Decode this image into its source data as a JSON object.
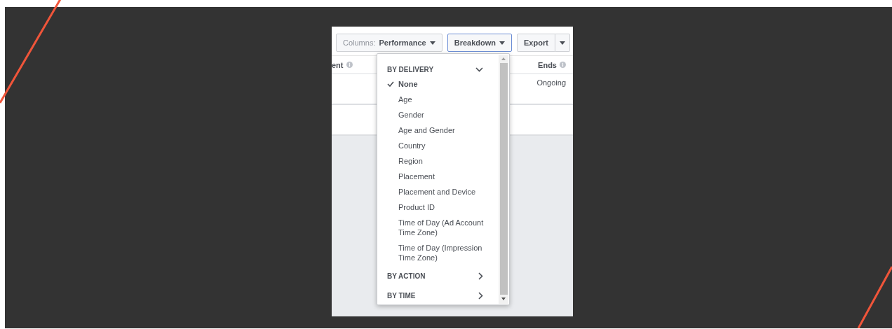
{
  "toolbar": {
    "buttons": [
      {
        "kind": "columns",
        "prefix": "Columns:",
        "label": "Performance",
        "selected": false
      },
      {
        "kind": "dropdown",
        "label": "Breakdown",
        "selected": true
      },
      {
        "kind": "split",
        "label": "Export",
        "selected": false
      }
    ]
  },
  "table": {
    "columns": [
      {
        "label": "ent"
      },
      {
        "label": "Ends"
      }
    ],
    "rows": [
      {
        "ends": "Ongoing"
      },
      {
        "ends": null
      }
    ]
  },
  "breakdown_menu": {
    "sections": [
      {
        "label": "BY DELIVERY",
        "expanded": true,
        "items": [
          {
            "label": "None",
            "selected": true
          },
          {
            "label": "Age",
            "selected": false
          },
          {
            "label": "Gender",
            "selected": false
          },
          {
            "label": "Age and Gender",
            "selected": false
          },
          {
            "label": "Country",
            "selected": false
          },
          {
            "label": "Region",
            "selected": false
          },
          {
            "label": "Placement",
            "selected": false
          },
          {
            "label": "Placement and Device",
            "selected": false
          },
          {
            "label": "Product ID",
            "selected": false
          },
          {
            "label": "Time of Day (Ad Account Time Zone)",
            "selected": false
          },
          {
            "label": "Time of Day (Impression Time Zone)",
            "selected": false
          }
        ]
      },
      {
        "label": "BY ACTION",
        "expanded": false
      },
      {
        "label": "BY TIME",
        "expanded": false
      }
    ]
  }
}
